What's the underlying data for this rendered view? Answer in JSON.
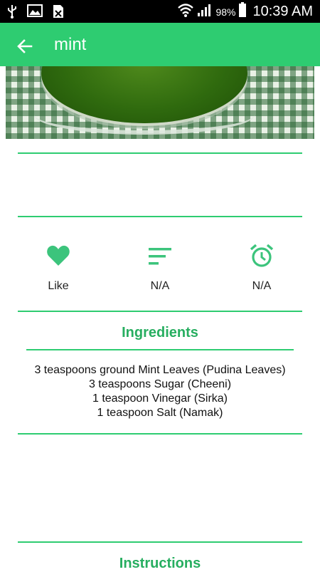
{
  "status_bar": {
    "battery_percent": "98%",
    "time": "10:39 AM",
    "icons": [
      "usb-icon",
      "image-icon",
      "sim-off-icon",
      "wifi-icon",
      "signal-icon",
      "battery-icon"
    ]
  },
  "app_bar": {
    "title": "mint",
    "back_icon": "arrow-left-icon",
    "color": "#2ecc71"
  },
  "stats": [
    {
      "icon": "heart-icon",
      "label": "Like"
    },
    {
      "icon": "sort-lines-icon",
      "label": "N/A"
    },
    {
      "icon": "alarm-clock-icon",
      "label": "N/A"
    }
  ],
  "ingredients": {
    "title": "Ingredients",
    "items": [
      "3 teaspoons ground Mint Leaves (Pudina Leaves)",
      "3 teaspoons Sugar (Cheeni)",
      "1 teaspoon Vinegar (Sirka)",
      "1 teaspoon Salt (Namak)"
    ]
  },
  "instructions": {
    "title": "Instructions"
  },
  "colors": {
    "accent": "#2ecc71",
    "title_green": "#27ae60",
    "icon_green": "#3cc47c"
  }
}
